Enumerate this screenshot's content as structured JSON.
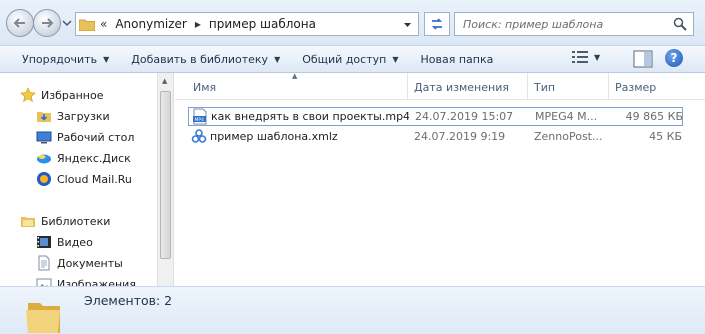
{
  "address": {
    "overflow": "«",
    "crumbs": [
      "Anonymizer",
      "пример шаблона"
    ],
    "separator": "▸"
  },
  "search": {
    "placeholder": "Поиск: пример шаблона"
  },
  "toolbar": {
    "organize": "Упорядочить",
    "add_to_library": "Добавить в библиотеку",
    "share": "Общий доступ",
    "new_folder": "Новая папка",
    "help": "?"
  },
  "nav": {
    "favorites": "Избранное",
    "downloads": "Загрузки",
    "desktop": "Рабочий стол",
    "yandex_disk": "Яндекс.Диск",
    "cloud_mail": "Cloud Mail.Ru",
    "libraries": "Библиотеки",
    "video": "Видео",
    "documents": "Документы",
    "images": "Изображения"
  },
  "columns": {
    "name": "Имя",
    "date": "Дата изменения",
    "type": "Тип",
    "size": "Размер"
  },
  "files": [
    {
      "name": "как внедрять в свои проекты.mp4",
      "date": "24.07.2019 15:07",
      "type": "MPEG4 M...",
      "size": "49 865 КБ",
      "icon": "mp4-file-icon"
    },
    {
      "name": "пример шаблона.xmlz",
      "date": "24.07.2019 9:19",
      "type": "ZennoPost...",
      "size": "45 КБ",
      "icon": "zennoposter-file-icon"
    }
  ],
  "details": {
    "count_text": "Элементов: 2"
  },
  "colors": {
    "accent": "#1d57b8",
    "selection_border": "#7da2ce",
    "folder": "#e8c15a"
  }
}
